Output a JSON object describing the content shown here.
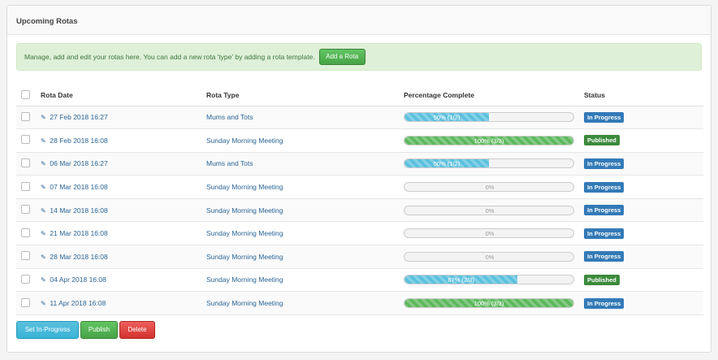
{
  "panel": {
    "title": "Upcoming Rotas"
  },
  "alert": {
    "text": "Manage, add and edit your rotas here. You can add a new rota 'type' by adding a rota template.",
    "button_label": "Add a Rota"
  },
  "table": {
    "headers": {
      "date": "Rota Date",
      "type": "Rota Type",
      "pct": "Percentage Complete",
      "status": "Status"
    },
    "rows": [
      {
        "date": "27 Feb 2018 16:27",
        "type": "Mums and Tots",
        "pct_text": "50%     (1/2)",
        "pct": 0.5,
        "bar": "info",
        "status": "In Progress",
        "status_color": "#337ab7"
      },
      {
        "date": "28 Feb 2018 16:08",
        "type": "Sunday Morning Meeting",
        "pct_text": "100%     (3/3)",
        "pct": 1.0,
        "bar": "success",
        "status": "Published",
        "status_color": "#3c8a3c"
      },
      {
        "date": "06 Mar 2018 16:27",
        "type": "Mums and Tots",
        "pct_text": "50%     (1/2)",
        "pct": 0.5,
        "bar": "info",
        "status": "In Progress",
        "status_color": "#337ab7"
      },
      {
        "date": "07 Mar 2018 16:08",
        "type": "Sunday Morning Meeting",
        "pct_text": "0%",
        "pct": 0,
        "bar": "info",
        "status": "In Progress",
        "status_color": "#337ab7"
      },
      {
        "date": "14 Mar 2018 16:08",
        "type": "Sunday Morning Meeting",
        "pct_text": "0%",
        "pct": 0,
        "bar": "info",
        "status": "In Progress",
        "status_color": "#337ab7"
      },
      {
        "date": "21 Mar 2018 16:08",
        "type": "Sunday Morning Meeting",
        "pct_text": "0%",
        "pct": 0,
        "bar": "info",
        "status": "In Progress",
        "status_color": "#337ab7"
      },
      {
        "date": "28 Mar 2018 16:08",
        "type": "Sunday Morning Meeting",
        "pct_text": "0%",
        "pct": 0,
        "bar": "info",
        "status": "In Progress",
        "status_color": "#337ab7"
      },
      {
        "date": "04 Apr 2018 16:08",
        "type": "Sunday Morning Meeting",
        "pct_text": "67%     (2/3)",
        "pct": 0.67,
        "bar": "info",
        "status": "Published",
        "status_color": "#3c8a3c"
      },
      {
        "date": "11 Apr 2018 16:08",
        "type": "Sunday Morning Meeting",
        "pct_text": "100%     (3/3)",
        "pct": 1.0,
        "bar": "success",
        "status": "In Progress",
        "status_color": "#337ab7"
      }
    ]
  },
  "actions": {
    "set_in_progress": "Set In-Progress",
    "publish": "Publish",
    "delete": "Delete"
  }
}
